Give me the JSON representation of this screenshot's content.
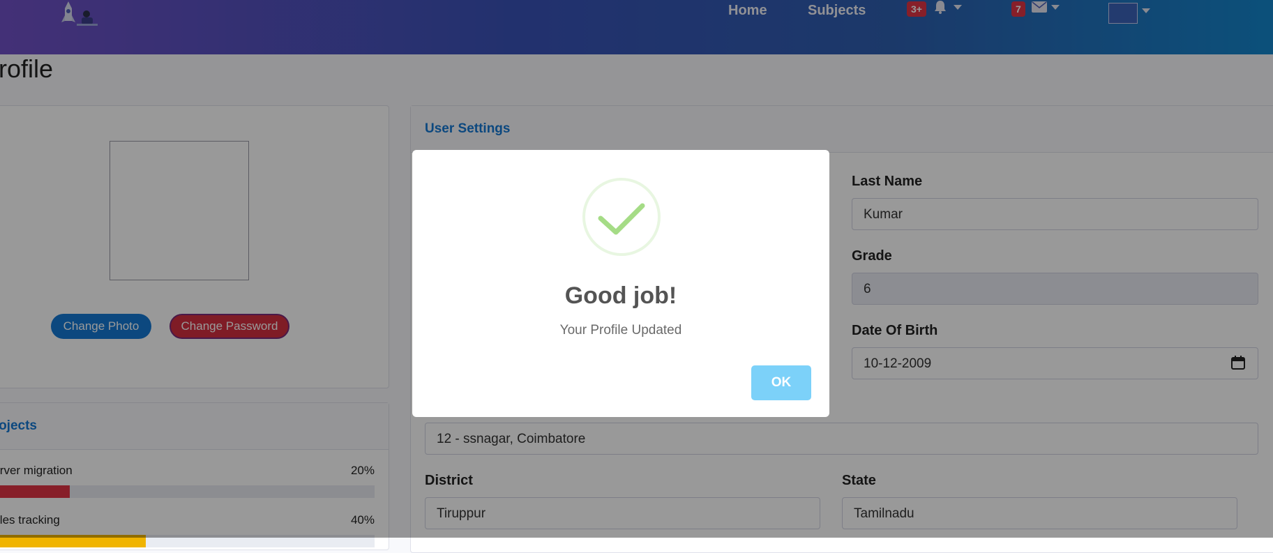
{
  "nav": {
    "home": "Home",
    "subjects": "Subjects",
    "alerts_count": "3+",
    "messages_count": "7"
  },
  "page": {
    "title": "Profile"
  },
  "profile_card": {
    "change_photo": "Change Photo",
    "change_password": "Change Password"
  },
  "projects": {
    "title": "Projects",
    "items": [
      {
        "label": "Server migration",
        "percent": "20%",
        "value": 20,
        "color": "#e23545"
      },
      {
        "label": "Sales tracking",
        "percent": "40%",
        "value": 40,
        "color": "#f0b400"
      }
    ]
  },
  "settings": {
    "title": "User Settings",
    "last_name_label": "Last Name",
    "last_name": "Kumar",
    "grade_label": "Grade",
    "grade": "6",
    "dob_label": "Date Of Birth",
    "dob": "10-12-2009",
    "address": "12 - ssnagar, Coimbatore",
    "district_label": "District",
    "district": "Tiruppur",
    "state_label": "State",
    "state": "Tamilnadu"
  },
  "dialog": {
    "title": "Good job!",
    "message": "Your Profile Updated",
    "ok": "OK"
  },
  "colors": {
    "accent": "#1478d4",
    "danger": "#e23545",
    "success": "#a5dc86",
    "ok_button": "#7cd1f9"
  }
}
